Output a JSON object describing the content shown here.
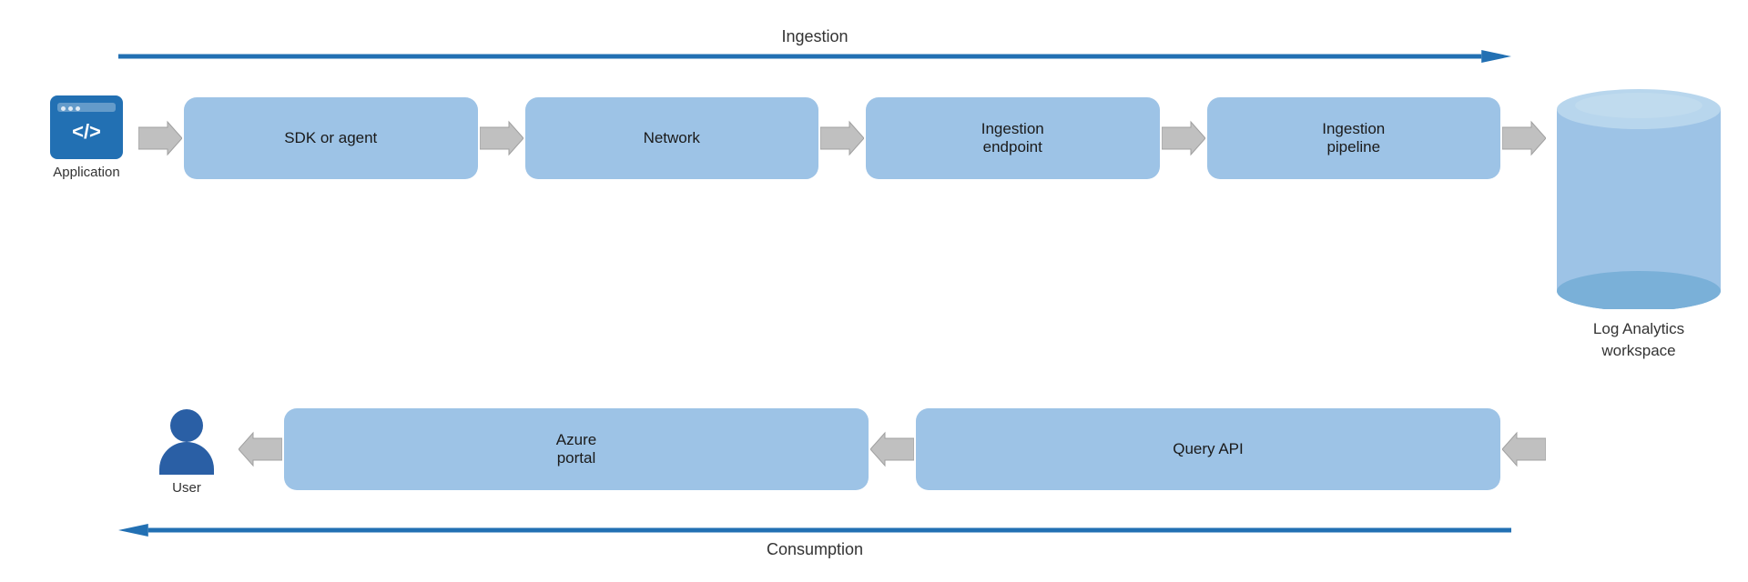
{
  "diagram": {
    "ingestion_label": "Ingestion",
    "consumption_label": "Consumption",
    "application_label": "Application",
    "user_label": "User",
    "log_analytics_label": "Log Analytics\nworkspace",
    "flow_boxes": [
      {
        "id": "sdk",
        "label": "SDK or agent"
      },
      {
        "id": "network",
        "label": "Network"
      },
      {
        "id": "ingestion_endpoint",
        "label": "Ingestion\nendpoint"
      },
      {
        "id": "ingestion_pipeline",
        "label": "Ingestion\npipeline"
      }
    ],
    "bottom_boxes": [
      {
        "id": "azure_portal",
        "label": "Azure\nportal"
      },
      {
        "id": "query_api",
        "label": "Query API"
      }
    ],
    "colors": {
      "box_fill": "#9dc3e6",
      "arrow_blue": "#2270b3",
      "arrow_gray": "#b0b0b0",
      "app_bg": "#2270b3",
      "user_color": "#2a5fa5",
      "cylinder_top": "#7ab0d8",
      "cylinder_body": "#9dc3e6"
    }
  }
}
